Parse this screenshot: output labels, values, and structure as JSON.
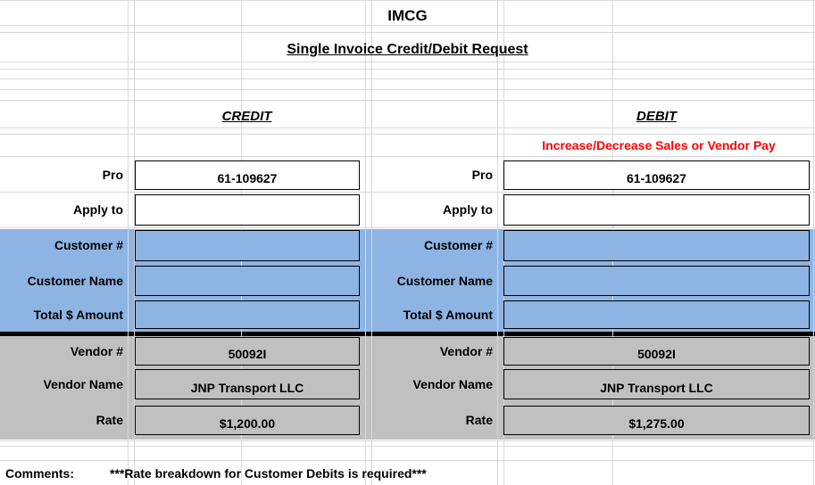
{
  "header": {
    "title": "IMCG",
    "subtitle": "Single Invoice Credit/Debit Request"
  },
  "credit": {
    "heading": "CREDIT",
    "labels": {
      "pro": "Pro",
      "apply_to": "Apply to",
      "customer_num": "Customer #",
      "customer_name": "Customer Name",
      "total_amount": "Total $ Amount",
      "vendor_num": "Vendor #",
      "vendor_name": "Vendor Name",
      "rate": "Rate"
    },
    "values": {
      "pro": "61-109627",
      "apply_to": "",
      "customer_num": "",
      "customer_name": "",
      "total_amount": "",
      "vendor_num": "50092I",
      "vendor_name": "JNP Transport LLC",
      "rate": "$1,200.00"
    }
  },
  "debit": {
    "heading": "DEBIT",
    "note": "Increase/Decrease Sales or Vendor Pay",
    "labels": {
      "pro": "Pro",
      "apply_to": "Apply to",
      "customer_num": "Customer #",
      "customer_name": "Customer Name",
      "total_amount": "Total $ Amount",
      "vendor_num": "Vendor #",
      "vendor_name": "Vendor Name",
      "rate": "Rate"
    },
    "values": {
      "pro": "61-109627",
      "apply_to": "",
      "customer_num": "",
      "customer_name": "",
      "total_amount": "",
      "vendor_num": "50092I",
      "vendor_name": "JNP Transport LLC",
      "rate": "$1,275.00"
    }
  },
  "footer": {
    "comments_label": "Comments:",
    "comments_text": "***Rate breakdown for Customer Debits is required***"
  },
  "colors": {
    "customer_band": "#8db4e2",
    "vendor_band": "#c0c0c0",
    "note": "#ff0000",
    "gridline": "#d9d9d9"
  }
}
